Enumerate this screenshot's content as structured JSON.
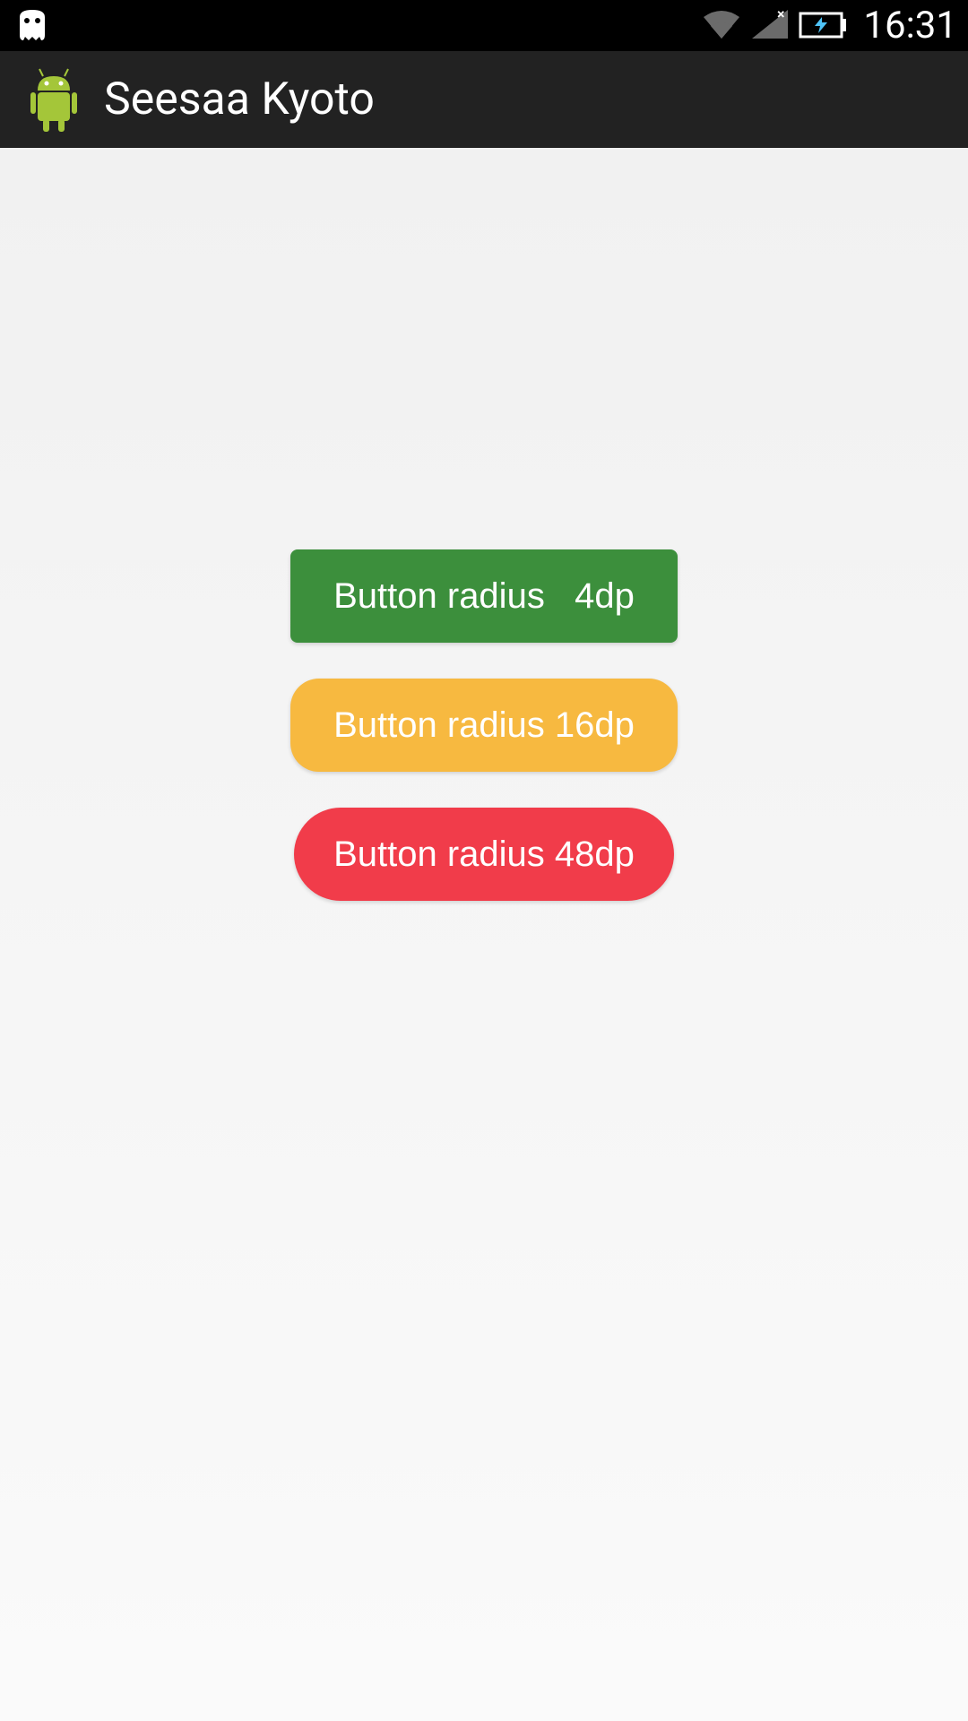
{
  "status_bar": {
    "time": "16:31"
  },
  "app_bar": {
    "title": "Seesaa Kyoto"
  },
  "buttons": {
    "btn_4dp_label": "Button radius   4dp",
    "btn_16dp_label": "Button radius 16dp",
    "btn_48dp_label": "Button radius 48dp"
  },
  "colors": {
    "btn_4dp": "#3c8f3c",
    "btn_16dp": "#f7b940",
    "btn_48dp": "#f13c4a",
    "status_bar_bg": "#000000",
    "app_bar_bg": "#222222"
  }
}
